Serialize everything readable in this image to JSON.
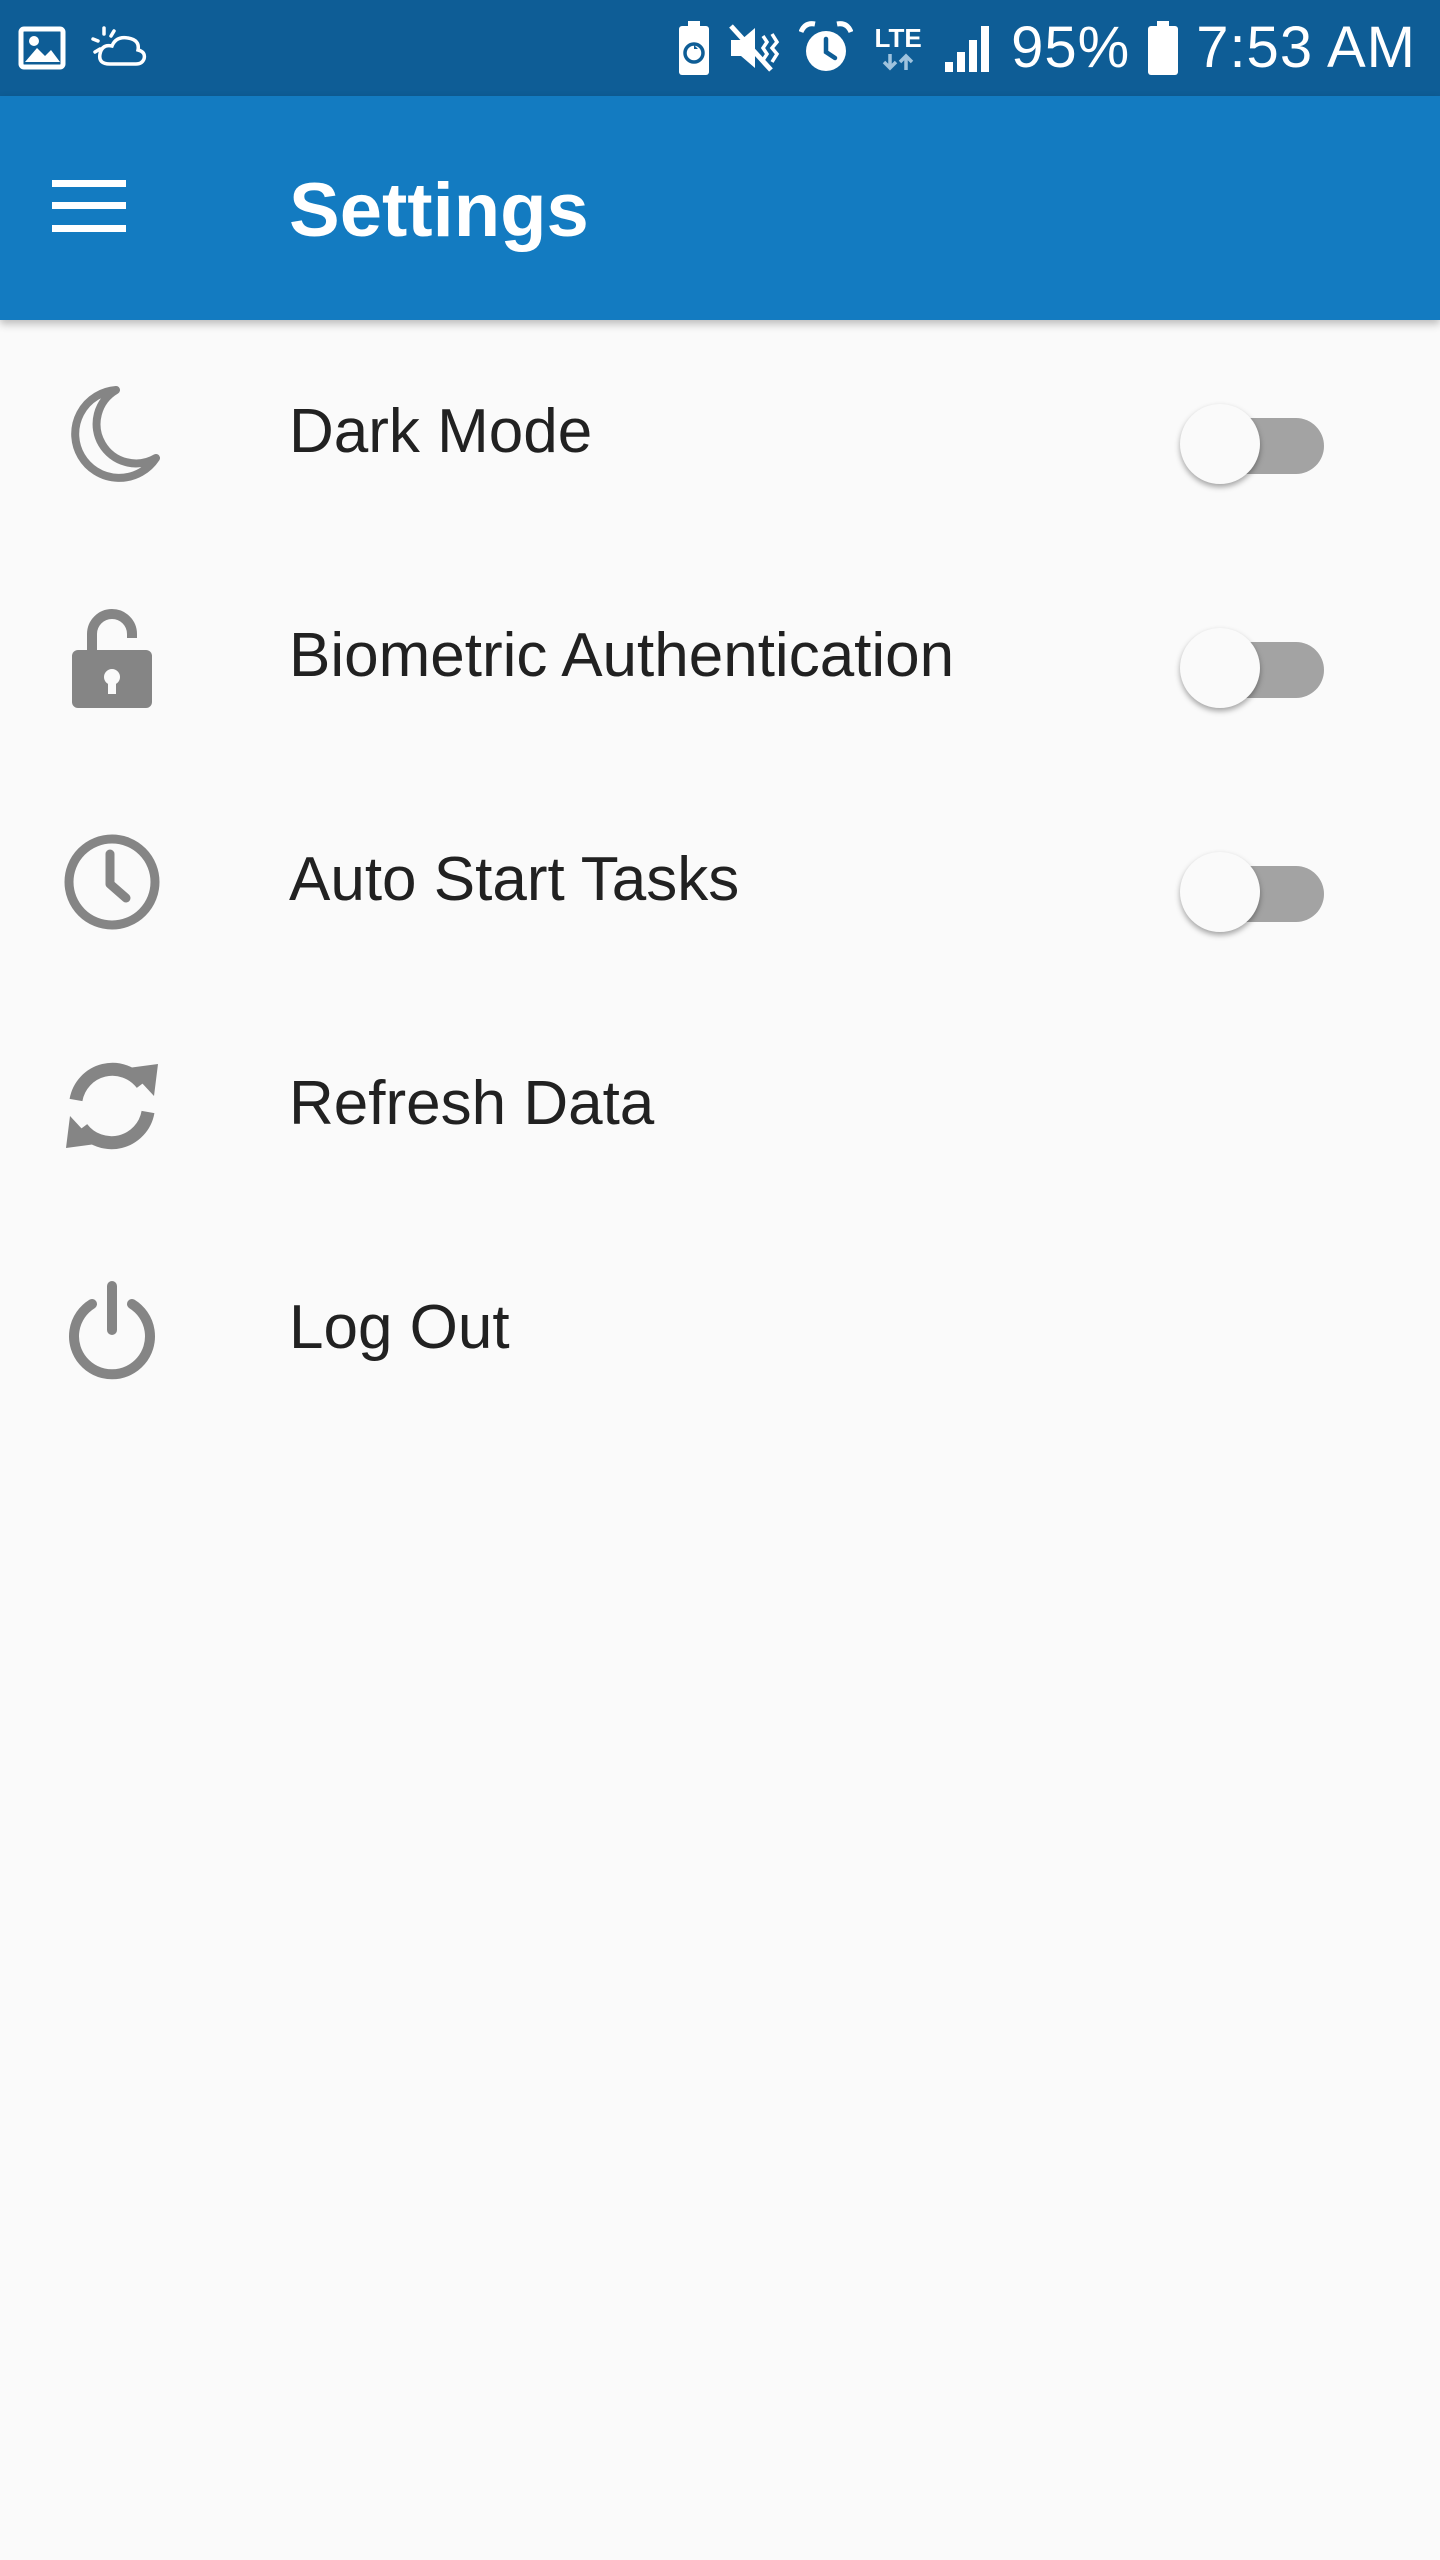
{
  "status_bar": {
    "icons_left": [
      "image-icon",
      "weather-cloud-icon"
    ],
    "icons_right": [
      "battery-saver-icon",
      "mute-icon",
      "alarm-icon",
      "lte-icon",
      "signal-icon",
      "battery-icon"
    ],
    "lte_label": "LTE",
    "battery_percent": "95%",
    "time": "7:53 AM",
    "background_color": "#0e5d96"
  },
  "app_bar": {
    "title": "Settings",
    "menu_icon": "hamburger-menu-icon",
    "background_color": "#137bc1"
  },
  "settings": {
    "items": [
      {
        "label": "Dark Mode",
        "icon": "moon-icon",
        "has_toggle": true,
        "toggle_on": false
      },
      {
        "label": "Biometric Authentication",
        "icon": "unlock-icon",
        "has_toggle": true,
        "toggle_on": false
      },
      {
        "label": "Auto Start Tasks",
        "icon": "clock-icon",
        "has_toggle": true,
        "toggle_on": false
      },
      {
        "label": "Refresh Data",
        "icon": "refresh-icon",
        "has_toggle": false
      },
      {
        "label": "Log Out",
        "icon": "power-icon",
        "has_toggle": false
      }
    ]
  },
  "colors": {
    "icon_gray": "#858585",
    "text": "#212121",
    "toggle_track_off": "#a3a3a3",
    "toggle_thumb_off": "#fafafa",
    "page_background": "#fafafa"
  }
}
